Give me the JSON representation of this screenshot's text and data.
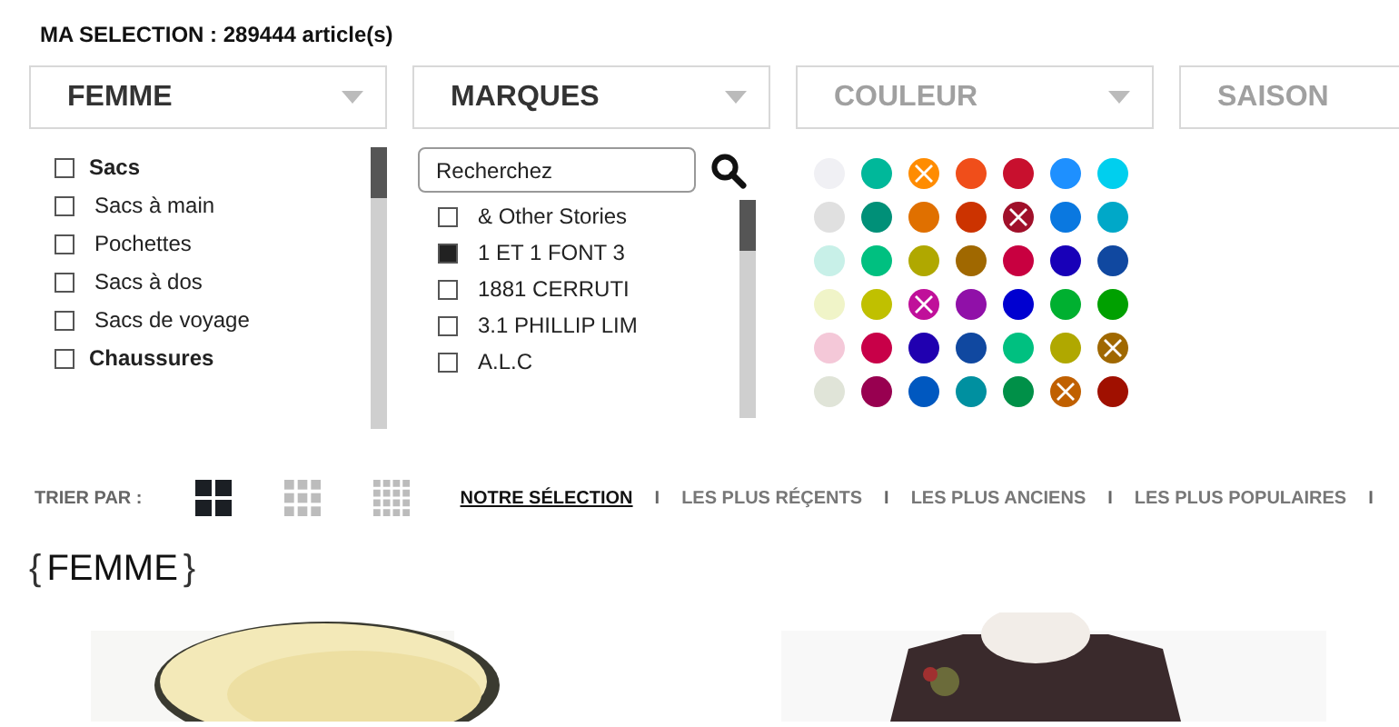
{
  "selection_count": "MA SELECTION : 289444 article(s)",
  "filters": [
    {
      "label": "FEMME",
      "disabled": false
    },
    {
      "label": "MARQUES",
      "disabled": false
    },
    {
      "label": "COULEUR",
      "disabled": true
    },
    {
      "label": "SAISON",
      "disabled": true
    }
  ],
  "femme_list": [
    {
      "kind": "category",
      "label": "Sacs",
      "checked": false
    },
    {
      "kind": "subcategory",
      "label": "Sacs à main",
      "checked": false
    },
    {
      "kind": "subcategory",
      "label": "Pochettes",
      "checked": false
    },
    {
      "kind": "subcategory",
      "label": "Sacs à dos",
      "checked": false
    },
    {
      "kind": "subcategory",
      "label": "Sacs de voyage",
      "checked": false
    },
    {
      "kind": "category",
      "label": "Chaussures",
      "checked": false
    }
  ],
  "brand_search": {
    "value": "Recherchez"
  },
  "brands": [
    {
      "label": "& Other Stories",
      "checked": false
    },
    {
      "label": "1 ET 1 FONT 3",
      "checked": true
    },
    {
      "label": "1881 CERRUTI",
      "checked": false
    },
    {
      "label": "3.1 PHILLIP LIM",
      "checked": false
    },
    {
      "label": "A.L.C",
      "checked": false
    }
  ],
  "colors": [
    [
      {
        "color": "#f0f0f4",
        "selected": false
      },
      {
        "color": "#00b89a",
        "selected": false
      },
      {
        "color": "#ff8c00",
        "selected": true
      },
      {
        "color": "#f04e1a",
        "selected": false
      },
      {
        "color": "#c8102e",
        "selected": false
      },
      {
        "color": "#1e90ff",
        "selected": false
      },
      {
        "color": "#00cfee",
        "selected": false
      }
    ],
    [
      {
        "color": "#e0e0e0",
        "selected": false
      },
      {
        "color": "#009078",
        "selected": false
      },
      {
        "color": "#e07000",
        "selected": false
      },
      {
        "color": "#cc3300",
        "selected": false
      },
      {
        "color": "#a0102a",
        "selected": true
      },
      {
        "color": "#0a78e0",
        "selected": false
      },
      {
        "color": "#00a8c8",
        "selected": false
      }
    ],
    [
      {
        "color": "#c8f0e8",
        "selected": false
      },
      {
        "color": "#00c080",
        "selected": false
      },
      {
        "color": "#b0a800",
        "selected": false
      },
      {
        "color": "#a06800",
        "selected": false
      },
      {
        "color": "#c80040",
        "selected": false
      },
      {
        "color": "#1800b8",
        "selected": false
      },
      {
        "color": "#1048a0",
        "selected": false
      }
    ],
    [
      {
        "color": "#f0f4c8",
        "selected": false
      },
      {
        "color": "#c0c000",
        "selected": false
      },
      {
        "color": "#c0109a",
        "selected": true
      },
      {
        "color": "#9010a8",
        "selected": false
      },
      {
        "color": "#0000d0",
        "selected": false
      },
      {
        "color": "#00b030",
        "selected": false
      },
      {
        "color": "#00a000",
        "selected": false
      }
    ],
    [
      {
        "color": "#f4c8d8",
        "selected": false
      },
      {
        "color": "#c80048",
        "selected": false
      },
      {
        "color": "#2000b0",
        "selected": false
      },
      {
        "color": "#1048a0",
        "selected": false
      },
      {
        "color": "#00c080",
        "selected": false
      },
      {
        "color": "#b0a800",
        "selected": false
      },
      {
        "color": "#a06800",
        "selected": true
      }
    ],
    [
      {
        "color": "#e0e4d8",
        "selected": false
      },
      {
        "color": "#980050",
        "selected": false
      },
      {
        "color": "#0058c0",
        "selected": false
      },
      {
        "color": "#0090a0",
        "selected": false
      },
      {
        "color": "#009048",
        "selected": false
      },
      {
        "color": "#c06000",
        "selected": true
      },
      {
        "color": "#a01000",
        "selected": false
      }
    ]
  ],
  "sort_label": "TRIER PAR :",
  "view_modes": [
    {
      "kind": "large",
      "selected": true
    },
    {
      "kind": "medium",
      "selected": false
    },
    {
      "kind": "small",
      "selected": false
    }
  ],
  "sort_options": [
    {
      "label": "NOTRE SÉLECTION",
      "selected": true,
      "separator": "I"
    },
    {
      "label": "LES PLUS RÉÇENTS",
      "selected": false,
      "separator": "I"
    },
    {
      "label": "LES PLUS ANCIENS",
      "selected": false,
      "separator": "I"
    },
    {
      "label": "LES PLUS POPULAIRES",
      "selected": false,
      "separator": "I"
    }
  ],
  "section_title": {
    "open": "{",
    "label": "FEMME",
    "close": "}"
  }
}
